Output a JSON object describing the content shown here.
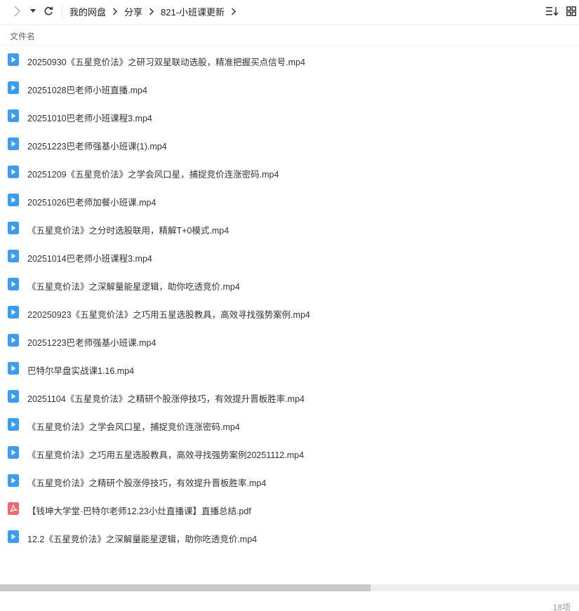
{
  "toolbar": {
    "breadcrumbs": [
      "我的网盘",
      "分享",
      "821-小班课更新"
    ]
  },
  "list_header": {
    "name_column": "文件名"
  },
  "files": [
    {
      "name": "20250930《五星竞价法》之研习双星联动选股，精准把握买点信号.mp4",
      "type": "video"
    },
    {
      "name": "20251028巴老师小班直播.mp4",
      "type": "video"
    },
    {
      "name": "20251010巴老师小班课程3.mp4",
      "type": "video"
    },
    {
      "name": "20251223巴老师强基小班课(1).mp4",
      "type": "video"
    },
    {
      "name": "20251209《五星竞价法》之学会风口星，捕捉竞价连涨密码.mp4",
      "type": "video"
    },
    {
      "name": "20251026巴老师加餐小班课.mp4",
      "type": "video"
    },
    {
      "name": "《五星竞价法》之分时选股联用，精解T+0模式.mp4",
      "type": "video"
    },
    {
      "name": "20251014巴老师小班课程3.mp4",
      "type": "video"
    },
    {
      "name": "《五星竞价法》之深解量能星逻辑，助你吃透竞价.mp4",
      "type": "video"
    },
    {
      "name": "220250923《五星竞价法》之巧用五星选股教具，高效寻找强势案例.mp4",
      "type": "video"
    },
    {
      "name": "20251223巴老师强基小班课.mp4",
      "type": "video"
    },
    {
      "name": "巴特尔早盘实战课1.16.mp4",
      "type": "video"
    },
    {
      "name": "20251104《五星竞价法》之精研个股涨停技巧，有效提升晋板胜率.mp4",
      "type": "video"
    },
    {
      "name": "《五星竞价法》之学会风口星，捕捉竞价连涨密码.mp4",
      "type": "video"
    },
    {
      "name": "《五星竞价法》之巧用五星选股教具，高效寻找强势案例20251112.mp4",
      "type": "video"
    },
    {
      "name": "《五星竞价法》之精研个股涨停技巧，有效提升晋板胜率.mp4",
      "type": "video"
    },
    {
      "name": "【钱坤大学堂·巴特尔老师12.23小灶直播课】直播总结.pdf",
      "type": "pdf"
    },
    {
      "name": "12.2《五星竞价法》之深解量能星逻辑，助你吃透竞价.mp4",
      "type": "video"
    }
  ],
  "scrollbar": {
    "horizontal_thumb_fraction": 0.64
  },
  "status": {
    "item_count": "18项"
  },
  "colors": {
    "video_icon": "#3a9cf3",
    "pdf_icon": "#f26a6f"
  }
}
